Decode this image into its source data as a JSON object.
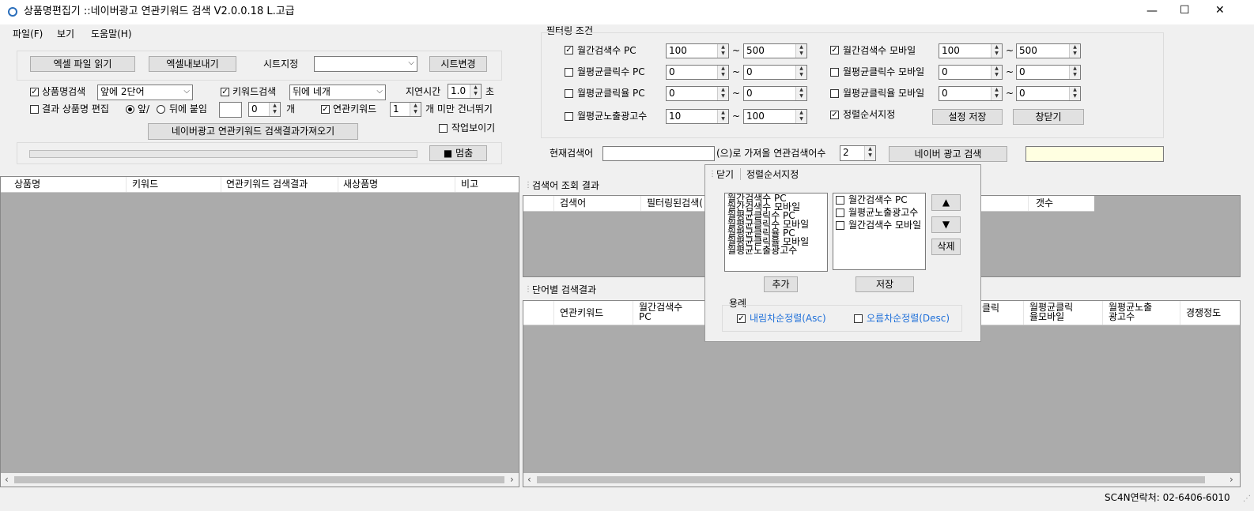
{
  "window": {
    "title": "상품명편집기 ::네이버광고 연관키워드 검색 V2.0.0.18 L.고급",
    "min": "—",
    "max": "☐",
    "close": "✕"
  },
  "menu": [
    "파일(F)",
    "보기",
    "도움말(H)"
  ],
  "toolbar": {
    "read_excel": "엑셀 파일 읽기",
    "export_excel": "엑셀내보내기",
    "sheet_label": "시트지정",
    "sheet_value": "",
    "sheet_change": "시트변경"
  },
  "options": {
    "product_search": "상품명검색",
    "product_combo": "앞에 2단어",
    "keyword_search": "키워드검색",
    "keyword_combo": "뒤에 네개",
    "delay_label": "지연시간",
    "delay_value": "1.0",
    "delay_unit": "초",
    "edit_result": "결과 상품명 편집",
    "front": "앞/",
    "back": "뒤에 붙임",
    "count_value": "0",
    "count_unit": "개",
    "related": "연관키워드",
    "skip_value": "1",
    "skip_label": "개 미만 건너뛰기",
    "fetch_button": "네이버광고 연관키워드 검색결과가져오기",
    "show_work": "작업보이기",
    "stop": "■ 멈춤"
  },
  "filter": {
    "title": "필터링 조건",
    "tilde": "~",
    "rows": [
      {
        "left": {
          "label": "월간검색수 PC",
          "checked": true,
          "min": "100",
          "max": "500"
        },
        "right": {
          "label": "월간검색수 모바일",
          "checked": true,
          "min": "100",
          "max": "500"
        }
      },
      {
        "left": {
          "label": "월평균클릭수 PC",
          "checked": false,
          "min": "0",
          "max": "0"
        },
        "right": {
          "label": "월평균클릭수 모바일",
          "checked": false,
          "min": "0",
          "max": "0"
        }
      },
      {
        "left": {
          "label": "월평균클릭율 PC",
          "checked": false,
          "min": "0",
          "max": "0"
        },
        "right": {
          "label": "월평균클릭율 모바일",
          "checked": false,
          "min": "0",
          "max": "0"
        }
      },
      {
        "left": {
          "label": "월평균노출광고수",
          "checked": false,
          "min": "10",
          "max": "100"
        }
      }
    ],
    "sort_label": "정렬순서지정",
    "save": "설정 저장",
    "close": "창닫기"
  },
  "search_bar": {
    "current_label": "현재검색어",
    "current_value": "",
    "fetch_label": "(으)로 가져올 연관검색어수",
    "fetch_count": "2",
    "naver_button": "네이버 광고 검색",
    "status": ""
  },
  "left_grid": {
    "columns": [
      "상품명",
      "키워드",
      "연관키워드 검색결과",
      "새상품명",
      "비고"
    ]
  },
  "lookup": {
    "title": "검색어 조회 결과",
    "columns": [
      "검색어",
      "필터링된검색(",
      "갯수"
    ]
  },
  "word_results": {
    "title": "단어별 검색결과",
    "columns": [
      "연관키워드",
      "월간검색수\nPC",
      "클릭",
      "월평균클릭\n율모바일",
      "월평균노출\n광고수",
      "경쟁정도"
    ]
  },
  "popup": {
    "tabs": [
      "닫기",
      "정렬순서지정"
    ],
    "available": [
      "월간검색수 PC",
      "월간검색수 모바일",
      "월평균클릭수 PC",
      "월평균클릭수 모바일",
      "월평균클릭율 PC",
      "월평균클릭율 모바일",
      "월평균노출광고수"
    ],
    "selected": [
      "월간검색수 PC",
      "월평균노출광고수",
      "월간검색수 모바일"
    ],
    "up": "▲",
    "down": "▼",
    "delete": "삭제",
    "add": "추가",
    "save": "저장",
    "legend_title": "용례",
    "desc": "내림차순정렬(Asc)",
    "asc": "오름차순정렬(Desc)"
  },
  "status": {
    "contact": "SC4N연락처: 02-6406-6010"
  }
}
